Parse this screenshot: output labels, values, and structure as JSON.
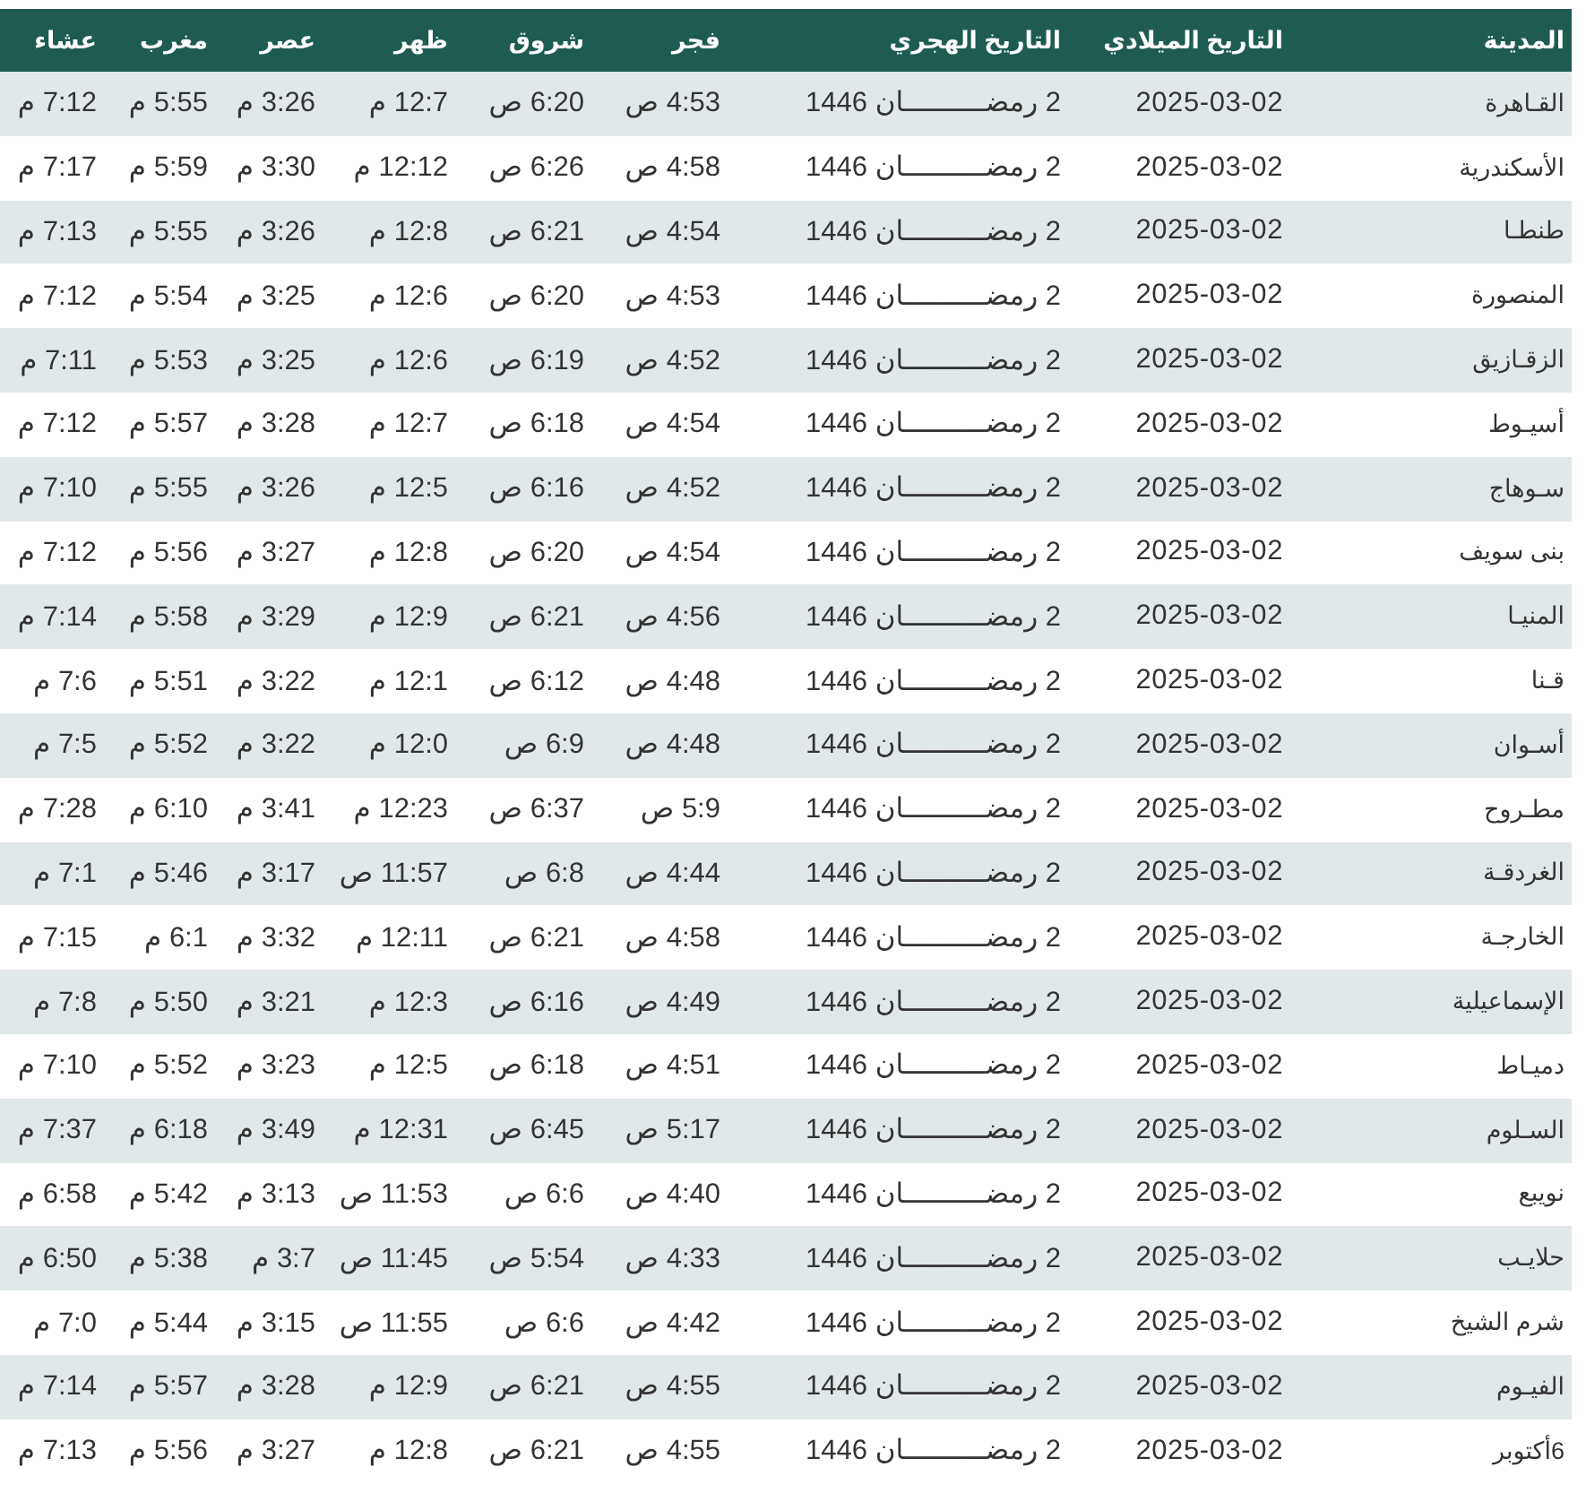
{
  "table": {
    "columns": [
      "المدينة",
      "التاريخ الميلادي",
      "التاريخ الهجري",
      "فجر",
      "شروق",
      "ظهر",
      "عصر",
      "مغرب",
      "عشاء"
    ],
    "rows": [
      {
        "cells": [
          "القـاهرة",
          "2025-03-02",
          "2 رمضــــــــــان 1446",
          "4:53 ص",
          "6:20 ص",
          "12:7 م",
          "3:26 م",
          "5:55 م",
          "7:12 م"
        ]
      },
      {
        "cells": [
          "الأسكندرية",
          "2025-03-02",
          "2 رمضــــــــــان 1446",
          "4:58 ص",
          "6:26 ص",
          "12:12 م",
          "3:30 م",
          "5:59 م",
          "7:17 م"
        ]
      },
      {
        "cells": [
          "طنطـا",
          "2025-03-02",
          "2 رمضــــــــــان 1446",
          "4:54 ص",
          "6:21 ص",
          "12:8 م",
          "3:26 م",
          "5:55 م",
          "7:13 م"
        ]
      },
      {
        "cells": [
          "المنصورة",
          "2025-03-02",
          "2 رمضــــــــــان 1446",
          "4:53 ص",
          "6:20 ص",
          "12:6 م",
          "3:25 م",
          "5:54 م",
          "7:12 م"
        ]
      },
      {
        "cells": [
          "الزقـازيق",
          "2025-03-02",
          "2 رمضــــــــــان 1446",
          "4:52 ص",
          "6:19 ص",
          "12:6 م",
          "3:25 م",
          "5:53 م",
          "7:11 م"
        ]
      },
      {
        "cells": [
          "أسيـوط",
          "2025-03-02",
          "2 رمضــــــــــان 1446",
          "4:54 ص",
          "6:18 ص",
          "12:7 م",
          "3:28 م",
          "5:57 م",
          "7:12 م"
        ]
      },
      {
        "cells": [
          "سـوهاج",
          "2025-03-02",
          "2 رمضــــــــــان 1446",
          "4:52 ص",
          "6:16 ص",
          "12:5 م",
          "3:26 م",
          "5:55 م",
          "7:10 م"
        ]
      },
      {
        "cells": [
          "بنى سويف",
          "2025-03-02",
          "2 رمضــــــــــان 1446",
          "4:54 ص",
          "6:20 ص",
          "12:8 م",
          "3:27 م",
          "5:56 م",
          "7:12 م"
        ]
      },
      {
        "cells": [
          "المنيـا",
          "2025-03-02",
          "2 رمضــــــــــان 1446",
          "4:56 ص",
          "6:21 ص",
          "12:9 م",
          "3:29 م",
          "5:58 م",
          "7:14 م"
        ]
      },
      {
        "cells": [
          "قـنا",
          "2025-03-02",
          "2 رمضــــــــــان 1446",
          "4:48 ص",
          "6:12 ص",
          "12:1 م",
          "3:22 م",
          "5:51 م",
          "7:6 م"
        ]
      },
      {
        "cells": [
          "أسـوان",
          "2025-03-02",
          "2 رمضــــــــــان 1446",
          "4:48 ص",
          "6:9 ص",
          "12:0 م",
          "3:22 م",
          "5:52 م",
          "7:5 م"
        ]
      },
      {
        "cells": [
          "مطـروح",
          "2025-03-02",
          "2 رمضــــــــــان 1446",
          "5:9 ص",
          "6:37 ص",
          "12:23 م",
          "3:41 م",
          "6:10 م",
          "7:28 م"
        ]
      },
      {
        "cells": [
          "الغردقـة",
          "2025-03-02",
          "2 رمضــــــــــان 1446",
          "4:44 ص",
          "6:8 ص",
          "11:57 ص",
          "3:17 م",
          "5:46 م",
          "7:1 م"
        ]
      },
      {
        "cells": [
          "الخارجـة",
          "2025-03-02",
          "2 رمضــــــــــان 1446",
          "4:58 ص",
          "6:21 ص",
          "12:11 م",
          "3:32 م",
          "6:1 م",
          "7:15 م"
        ]
      },
      {
        "cells": [
          "الإسماعيلية",
          "2025-03-02",
          "2 رمضــــــــــان 1446",
          "4:49 ص",
          "6:16 ص",
          "12:3 م",
          "3:21 م",
          "5:50 م",
          "7:8 م"
        ]
      },
      {
        "cells": [
          "دميـاط",
          "2025-03-02",
          "2 رمضــــــــــان 1446",
          "4:51 ص",
          "6:18 ص",
          "12:5 م",
          "3:23 م",
          "5:52 م",
          "7:10 م"
        ]
      },
      {
        "cells": [
          "السـلوم",
          "2025-03-02",
          "2 رمضــــــــــان 1446",
          "5:17 ص",
          "6:45 ص",
          "12:31 م",
          "3:49 م",
          "6:18 م",
          "7:37 م"
        ]
      },
      {
        "cells": [
          "نويبع",
          "2025-03-02",
          "2 رمضــــــــــان 1446",
          "4:40 ص",
          "6:6 ص",
          "11:53 ص",
          "3:13 م",
          "5:42 م",
          "6:58 م"
        ]
      },
      {
        "cells": [
          "حلايـب",
          "2025-03-02",
          "2 رمضــــــــــان 1446",
          "4:33 ص",
          "5:54 ص",
          "11:45 ص",
          "3:7 م",
          "5:38 م",
          "6:50 م"
        ]
      },
      {
        "cells": [
          "شرم الشيخ",
          "2025-03-02",
          "2 رمضــــــــــان 1446",
          "4:42 ص",
          "6:6 ص",
          "11:55 ص",
          "3:15 م",
          "5:44 م",
          "7:0 م"
        ]
      },
      {
        "cells": [
          "الفيـوم",
          "2025-03-02",
          "2 رمضــــــــــان 1446",
          "4:55 ص",
          "6:21 ص",
          "12:9 م",
          "3:28 م",
          "5:57 م",
          "7:14 م"
        ]
      },
      {
        "cells": [
          "6أكتوبر",
          "2025-03-02",
          "2 رمضــــــــــان 1446",
          "4:55 ص",
          "6:21 ص",
          "12:8 م",
          "3:27 م",
          "5:56 م",
          "7:13 م"
        ]
      }
    ]
  }
}
